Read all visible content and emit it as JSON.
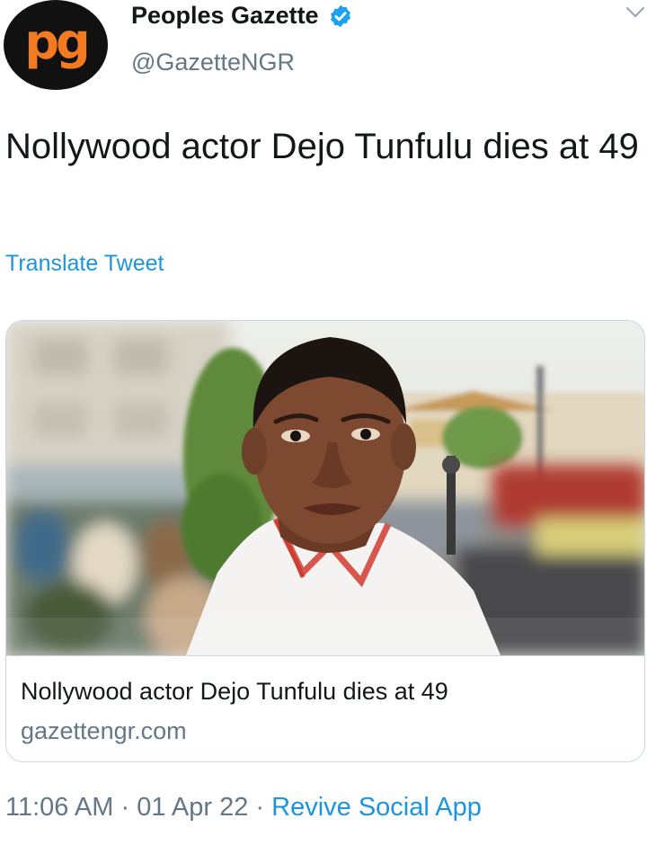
{
  "author": {
    "display_name": "Peoples Gazette",
    "handle": "@GazetteNGR",
    "avatar_text": "pg",
    "avatar_icon": "peoples-gazette-logo",
    "verified_icon": "verified-badge-icon"
  },
  "header": {
    "menu_icon": "chevron-down-icon"
  },
  "tweet": {
    "text": "Nollywood actor Dejo Tunfulu dies at 49",
    "translate_label": "Translate Tweet"
  },
  "card": {
    "title": "Nollywood actor Dejo Tunfulu dies at 49",
    "domain": "gazettengr.com"
  },
  "footer": {
    "time": "11:06 AM",
    "separator": "·",
    "date": "01 Apr 22",
    "source": "Revive Social App"
  },
  "colors": {
    "link": "#1b95e0",
    "secondary_text": "#657786",
    "primary_text": "#14171a",
    "brand_orange": "#f47a20",
    "verified_blue": "#1da1f2",
    "border": "#ccd6dd"
  }
}
